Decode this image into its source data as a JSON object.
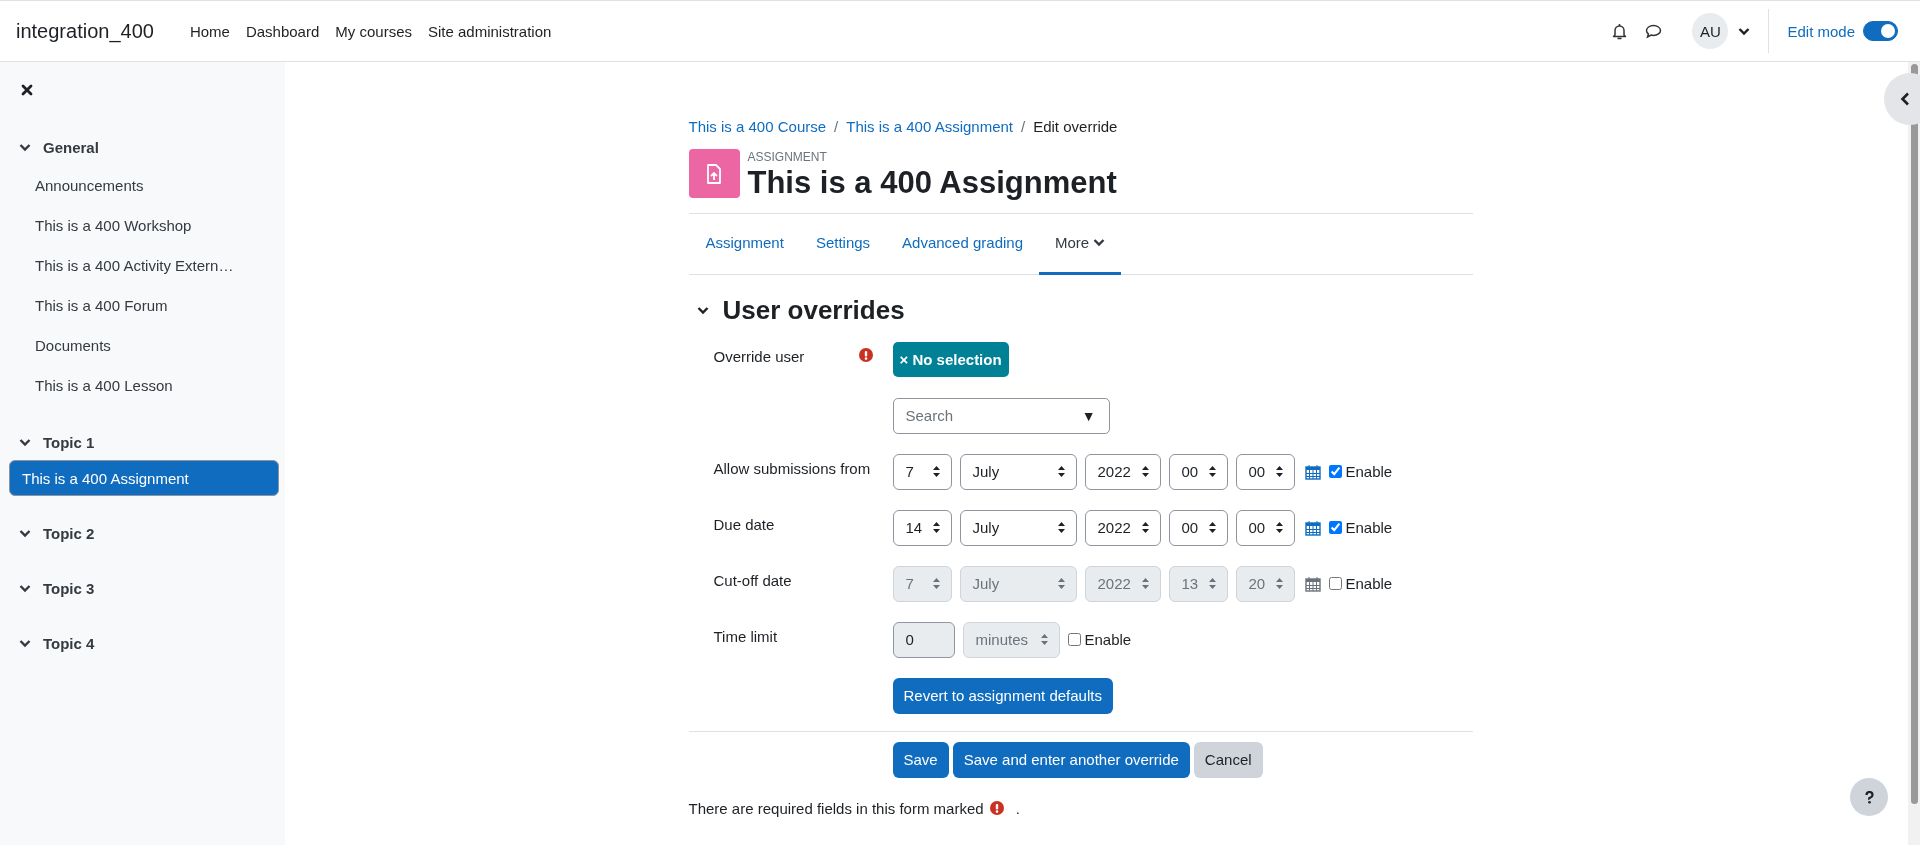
{
  "navbar": {
    "site_name": "integration_400",
    "links": [
      {
        "label": "Home"
      },
      {
        "label": "Dashboard"
      },
      {
        "label": "My courses"
      },
      {
        "label": "Site administration"
      }
    ],
    "avatar": "AU",
    "edit_mode": {
      "label": "Edit mode",
      "on": true
    }
  },
  "drawer": {
    "sections": [
      {
        "title": "General",
        "expanded": true,
        "items": [
          {
            "label": "Announcements",
            "selected": false
          },
          {
            "label": "This is a 400 Workshop",
            "selected": false
          },
          {
            "label": "This is a 400 Activity Extern…",
            "selected": false
          },
          {
            "label": "This is a 400 Forum",
            "selected": false
          },
          {
            "label": "Documents",
            "selected": false
          },
          {
            "label": "This is a 400 Lesson",
            "selected": false
          }
        ]
      },
      {
        "title": "Topic 1",
        "expanded": true,
        "items": [
          {
            "label": "This is a 400 Assignment",
            "selected": true
          }
        ]
      },
      {
        "title": "Topic 2",
        "expanded": true
      },
      {
        "title": "Topic 3",
        "expanded": true
      },
      {
        "title": "Topic 4",
        "expanded": true
      }
    ]
  },
  "breadcrumb": [
    {
      "label": "This is a 400 Course",
      "kind": "link"
    },
    {
      "separator": "/",
      "label": "This is a 400 Assignment",
      "kind": "link"
    },
    {
      "separator": "/",
      "label": "Edit override",
      "kind": "current"
    }
  ],
  "activity": {
    "type": "ASSIGNMENT",
    "title": "This is a 400 Assignment"
  },
  "tabs": [
    {
      "label": "Assignment",
      "kind": "link",
      "selected": false
    },
    {
      "label": "Settings",
      "kind": "link",
      "selected": false
    },
    {
      "label": "Advanced grading",
      "kind": "link",
      "selected": false
    },
    {
      "label": "More",
      "kind": "menu",
      "selected": true
    }
  ],
  "section": {
    "title": "User overrides",
    "expanded": true
  },
  "form": [
    {
      "kind": "autocomplete",
      "label": "Override user",
      "required": true,
      "chip": "× No selection",
      "placeholder": "Search",
      "caret": "▼"
    },
    {
      "kind": "date",
      "label": "Allow submissions from",
      "checked": true,
      "check_label": "Enable",
      "fields": [
        {
          "value": "7"
        },
        {
          "value": "July"
        },
        {
          "value": "2022"
        },
        {
          "value": "00"
        },
        {
          "value": "00"
        }
      ]
    },
    {
      "kind": "date",
      "label": "Due date",
      "checked": true,
      "check_label": "Enable",
      "fields": [
        {
          "value": "14"
        },
        {
          "value": "July"
        },
        {
          "value": "2022"
        },
        {
          "value": "00"
        },
        {
          "value": "00"
        }
      ]
    },
    {
      "kind": "date",
      "label": "Cut-off date",
      "checked": false,
      "check_label": "Enable",
      "fields": [
        {
          "value": "7"
        },
        {
          "value": "July"
        },
        {
          "value": "2022"
        },
        {
          "value": "13"
        },
        {
          "value": "20"
        }
      ]
    },
    {
      "kind": "duration",
      "label": "Time limit",
      "checked": false,
      "check_label": "Enable",
      "value": "0",
      "unit": "minutes"
    },
    {
      "kind": "button",
      "label": "Revert to assignment defaults"
    }
  ],
  "buttons": [
    {
      "label": "Save",
      "kind": "primary"
    },
    {
      "label": "Save and enter another override",
      "kind": "primary"
    },
    {
      "label": "Cancel",
      "kind": "secondary"
    }
  ],
  "required_note": {
    "before": "There are required fields in this form marked",
    "after": "."
  }
}
